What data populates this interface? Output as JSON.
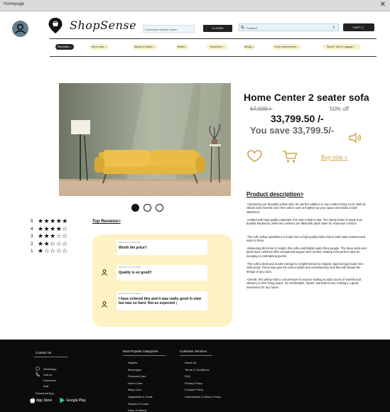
{
  "window": {
    "title": "Homepage",
    "close_glyph": "✕"
  },
  "header": {
    "logo_text": "ShopSense",
    "login_input": "Customize website option",
    "login_button": "▾ LOGIN",
    "search_placeholder": "Furniture",
    "search_spinner": "⇕",
    "cart_button": "CART 🛒"
  },
  "categories": [
    {
      "label": "Electricals ⌄",
      "active": true
    },
    {
      "label": "Men's wear ⌄",
      "active": false
    },
    {
      "label": "Beauty & Barber ⌄",
      "active": false
    },
    {
      "label": "Stuffed ⌄",
      "active": false
    },
    {
      "label": "Electronics ⌄",
      "active": false
    },
    {
      "label": "Beauty ⌄",
      "active": false
    },
    {
      "label": "Home Improvement ⌄",
      "active": false
    },
    {
      "label": "Sports, Toys & Luggage ⌄",
      "active": false
    }
  ],
  "product": {
    "name": "Home Center  2 seater sofa",
    "old_price": "67,599 /-",
    "discount": "50% off",
    "price": "33,799.50 /-",
    "saving": "You save 33,799.5/-",
    "buy_now": "Buy now »",
    "carousel": {
      "count": 3,
      "active_index": 0
    }
  },
  "description": {
    "title": "Product description>",
    "paragraphs": [
      "-Introducing our beautiful yellow sofa, the perfect addition to any modern living room. With its vibrant and cheerful color, this sofa is sure to brighten up your space and make a bold statement.",
      "-Crafted with high-quality materials, this sofa is built to last. The sturdy frame is made from durable hardwood, while the cushions are filled with plush foam for maximum comfort.",
      "-The soft, yellow upholstery is made from a high-quality fabric that is both stain-resistant and easy to clean.",
      "-Measuring 86 inches in length, this sofa comfortably seats three people. The deep seats and plush back cushions offer exceptional support and comfort, making it the perfect spot for lounging or entertaining guests.",
      "-The sofa's sleek and modern design is complemented by elegant, tapered legs made from solid wood. These legs give the sofa a stylish and contemporary look that will elevate the design of any room.",
      "-Overall, this yellow sofa is a must-have for anyone looking to add a touch of warmth and vibrancy to their living space. It's comfortable, stylish, and built to last, making it a great investment for any home."
    ]
  },
  "ratings": [
    {
      "label": "5",
      "stars": "★★★★★"
    },
    {
      "label": "4",
      "stars": "★★★★☆"
    },
    {
      "label": "3",
      "stars": "★★★☆☆"
    },
    {
      "label": "2",
      "stars": "★★☆☆☆"
    },
    {
      "label": "1",
      "stars": "★☆☆☆☆"
    }
  ],
  "reviews": {
    "title": "Top Reviews>",
    "items": [
      {
        "meta": "Reviewed on 16 April 2023",
        "text": "Worth the price!!"
      },
      {
        "meta": "Reviewed on 16 April 2023",
        "text": "Quality is so good!!"
      },
      {
        "meta": "Reviewed on 16 April 2023",
        "text": "I have ordered this and it was really good in view but was so hard. Not as expected ¡"
      }
    ]
  },
  "footer": {
    "contact": {
      "title": "Contact Us",
      "items": [
        "WhatsApp",
        "Call us",
        "Facebook",
        "Mail"
      ]
    },
    "download_label": "Download App",
    "stores": [
      "App Store",
      "Google Play"
    ],
    "popular": {
      "title": "Most Popular Categories",
      "items": [
        "Staples",
        "Beverages",
        "Personal Care",
        "Home Care",
        "Baby Care",
        "Vegetables & Fruits",
        "Snacks & Foods",
        "Dairy & Bakery"
      ]
    },
    "service": {
      "title": "Customer Services",
      "items": [
        "About Us",
        "Terms & Conditions",
        "FAQ",
        "Privacy Policy",
        "E-waste Policy",
        "Cancellation & Return Policy"
      ]
    }
  },
  "colors": {
    "accent_yellow": "#c8a646",
    "review_panel": "#fdf2c3",
    "chip": "#f7f1c8",
    "footer": "#0c0c0c"
  }
}
